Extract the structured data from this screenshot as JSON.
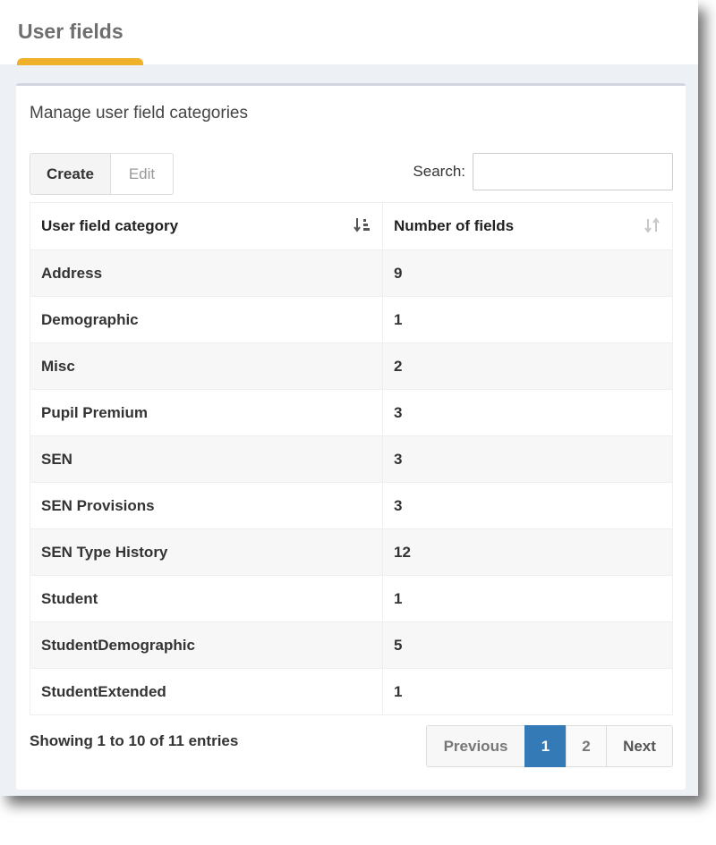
{
  "header": {
    "title": "User fields"
  },
  "panel": {
    "title": "Manage user field categories",
    "buttons": {
      "create": "Create",
      "edit": "Edit"
    },
    "search": {
      "label": "Search:",
      "value": "",
      "placeholder": ""
    }
  },
  "table": {
    "columns": [
      "User field category",
      "Number of fields"
    ],
    "rows": [
      [
        "Address",
        "9"
      ],
      [
        "Demographic",
        "1"
      ],
      [
        "Misc",
        "2"
      ],
      [
        "Pupil Premium",
        "3"
      ],
      [
        "SEN",
        "3"
      ],
      [
        "SEN Provisions",
        "3"
      ],
      [
        "SEN Type History",
        "12"
      ],
      [
        "Student",
        "1"
      ],
      [
        "StudentDemographic",
        "5"
      ],
      [
        "StudentExtended",
        "1"
      ]
    ]
  },
  "footer": {
    "info": "Showing 1 to 10 of 11 entries",
    "pagination": {
      "previous": "Previous",
      "pages": [
        "1",
        "2"
      ],
      "next": "Next",
      "active_page": "1"
    }
  },
  "colors": {
    "accent": "#f0b12a",
    "active_page": "#337ab7"
  }
}
